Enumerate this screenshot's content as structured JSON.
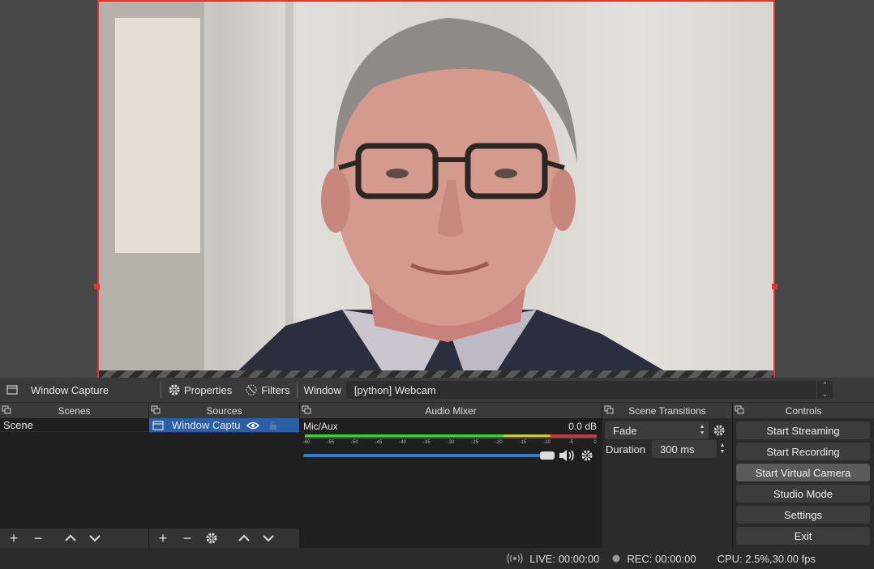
{
  "context_bar": {
    "source_name": "Window Capture",
    "properties_label": "Properties",
    "filters_label": "Filters",
    "window_label": "Window",
    "window_value": "[python] Webcam"
  },
  "scenes": {
    "title": "Scenes",
    "items": [
      "Scene"
    ]
  },
  "sources": {
    "title": "Sources",
    "items": [
      {
        "label": "Window Captu",
        "visible": true,
        "locked": false
      }
    ]
  },
  "mixer": {
    "title": "Audio Mixer",
    "channel_name": "Mic/Aux",
    "level": "0.0 dB",
    "ticks": [
      "-60",
      "-55",
      "-50",
      "-45",
      "-40",
      "-35",
      "-30",
      "-25",
      "-20",
      "-15",
      "-10",
      "-5",
      "0"
    ],
    "volume_fraction": 1.0
  },
  "transitions": {
    "title": "Scene Transitions",
    "transition": "Fade",
    "duration_label": "Duration",
    "duration_value": "300 ms"
  },
  "controls": {
    "title": "Controls",
    "buttons": [
      "Start Streaming",
      "Start Recording",
      "Start Virtual Camera",
      "Studio Mode",
      "Settings",
      "Exit"
    ]
  },
  "status": {
    "live": "LIVE: 00:00:00",
    "rec": "REC: 00:00:00",
    "cpu": "CPU: 2.5%,30.00 fps"
  },
  "colors": {
    "accent": "#2a5fa6",
    "selection_border": "#e53333",
    "meter_green": "#4ad94a"
  }
}
